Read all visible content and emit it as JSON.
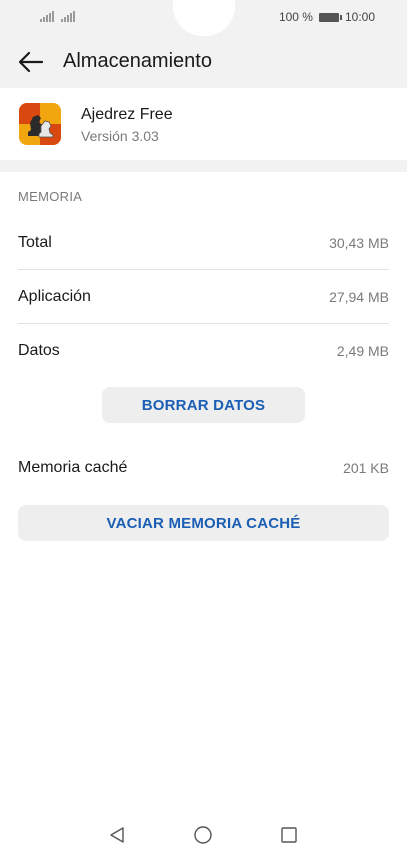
{
  "status_bar": {
    "battery_text": "100 %",
    "time": "10:00"
  },
  "appbar": {
    "title": "Almacenamiento"
  },
  "app": {
    "name": "Ajedrez Free",
    "version": "Versión 3.03"
  },
  "memory": {
    "section_label": "MEMORIA",
    "rows": [
      {
        "label": "Total",
        "value": "30,43 MB"
      },
      {
        "label": "Aplicación",
        "value": "27,94 MB"
      },
      {
        "label": "Datos",
        "value": "2,49 MB"
      }
    ],
    "clear_data_label": "BORRAR DATOS"
  },
  "cache": {
    "label": "Memoria caché",
    "value": "201 KB",
    "clear_cache_label": "VACIAR MEMORIA CACHÉ"
  },
  "colors": {
    "accent": "#1a5fb4",
    "app_icon_bg": "#f1a60f"
  }
}
